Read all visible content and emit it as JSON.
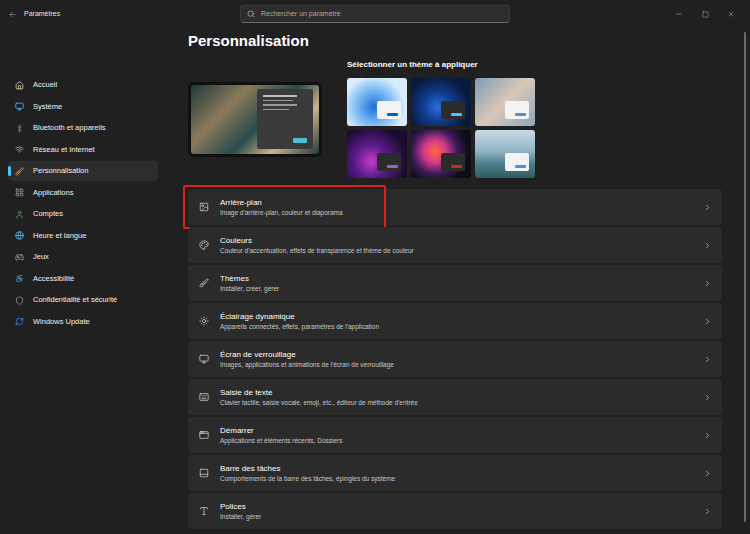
{
  "window": {
    "title": "Paramètres"
  },
  "search": {
    "placeholder": "Rechercher un paramètre"
  },
  "sidebar": {
    "items": [
      {
        "label": "Accueil",
        "selected": false
      },
      {
        "label": "Système",
        "selected": false
      },
      {
        "label": "Bluetooth et appareils",
        "selected": false
      },
      {
        "label": "Réseau et Internet",
        "selected": false
      },
      {
        "label": "Personnalisation",
        "selected": true
      },
      {
        "label": "Applications",
        "selected": false
      },
      {
        "label": "Comptes",
        "selected": false
      },
      {
        "label": "Heure et langue",
        "selected": false
      },
      {
        "label": "Jeux",
        "selected": false
      },
      {
        "label": "Accessibilité",
        "selected": false
      },
      {
        "label": "Confidentialité et sécurité",
        "selected": false
      },
      {
        "label": "Windows Update",
        "selected": false
      }
    ]
  },
  "page": {
    "title": "Personnalisation",
    "themes_title": "Sélectionner un thème à appliquer",
    "themes": [
      {
        "color": "#0067c0",
        "dark": false
      },
      {
        "color": "#4cc2ff",
        "dark": true
      },
      {
        "color": "#5a8fbf",
        "dark": false
      },
      {
        "color": "#9d5fd0",
        "dark": true
      },
      {
        "color": "#c42b1c",
        "dark": true
      },
      {
        "color": "#3a96dd",
        "dark": false
      }
    ]
  },
  "settings": [
    {
      "title": "Arrière-plan",
      "subtitle": "Image d'arrière-plan, couleur et diaporama",
      "highlighted": true
    },
    {
      "title": "Couleurs",
      "subtitle": "Couleur d'accentuation, effets de transparence et thème de couleur",
      "highlighted": false
    },
    {
      "title": "Thèmes",
      "subtitle": "Installer, créer, gérer",
      "highlighted": false
    },
    {
      "title": "Éclairage dynamique",
      "subtitle": "Appareils connectés, effets, paramètres de l'application",
      "highlighted": false
    },
    {
      "title": "Écran de verrouillage",
      "subtitle": "Images, applications et animations de l'écran de verrouillage",
      "highlighted": false
    },
    {
      "title": "Saisie de texte",
      "subtitle": "Clavier tactile, saisie vocale, emoji, etc., éditeur de méthode d'entrée",
      "highlighted": false
    },
    {
      "title": "Démarrer",
      "subtitle": "Applications et éléments récents, Dossiers",
      "highlighted": false
    },
    {
      "title": "Barre des tâches",
      "subtitle": "Comportements de la barre des tâches, épingles du système",
      "highlighted": false
    },
    {
      "title": "Polices",
      "subtitle": "Installer, gérer",
      "highlighted": false
    }
  ]
}
